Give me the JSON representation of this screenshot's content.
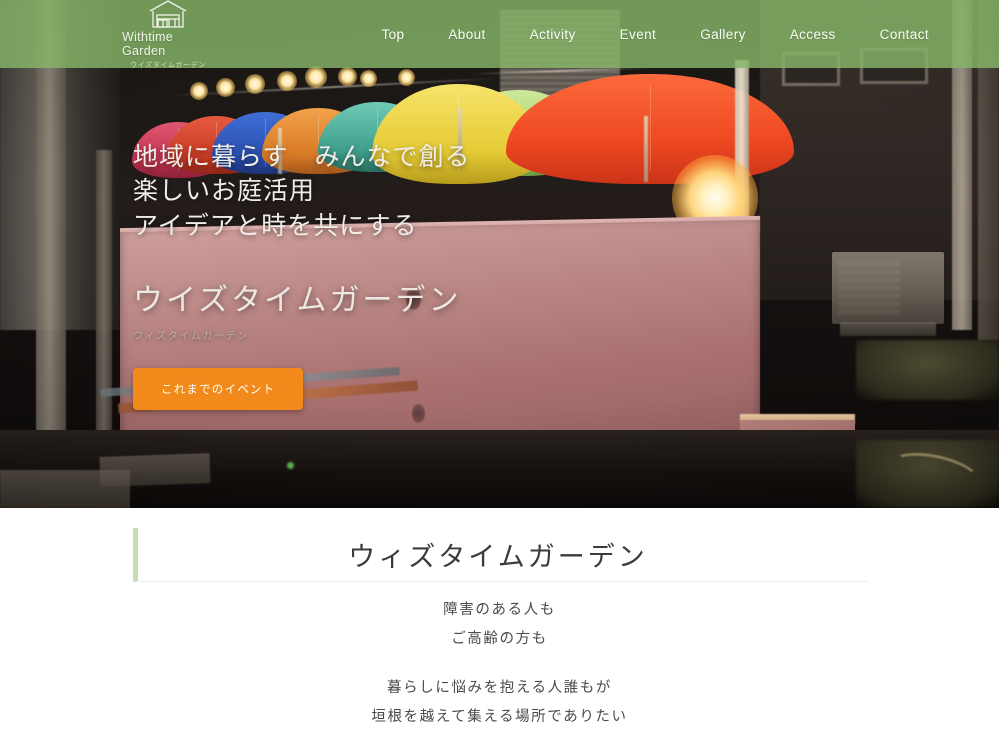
{
  "header": {
    "logo": {
      "icon": "house-shop-icon",
      "name": "Withtime Garden",
      "sub": "ウイズタイムガーデン"
    },
    "nav": [
      {
        "label": "Top"
      },
      {
        "label": "About"
      },
      {
        "label": "Activity"
      },
      {
        "label": "Event"
      },
      {
        "label": "Gallery"
      },
      {
        "label": "Access"
      },
      {
        "label": "Contact"
      }
    ],
    "background_color": "#86B669"
  },
  "hero": {
    "lines": [
      "地域に暮らす　みんなで創る",
      "楽しいお庭活用",
      "アイデアと時を共にする"
    ],
    "title": "ウイズタイムガーデン",
    "subtitle": "ウィズタイムガーデン",
    "cta_label": "これまでのイベント",
    "cta_color": "#F18A1A",
    "image_description": "夜のお庭に並ぶカラフルな傘と電球ストリングライト"
  },
  "section": {
    "title": "ウィズタイムガーデン",
    "accent_color": "#C8DDB1",
    "paragraph_1": [
      "障害のある人も",
      "ご高齢の方も"
    ],
    "paragraph_2": [
      "暮らしに悩みを抱える人誰もが",
      "垣根を越えて集える場所でありたい"
    ]
  }
}
